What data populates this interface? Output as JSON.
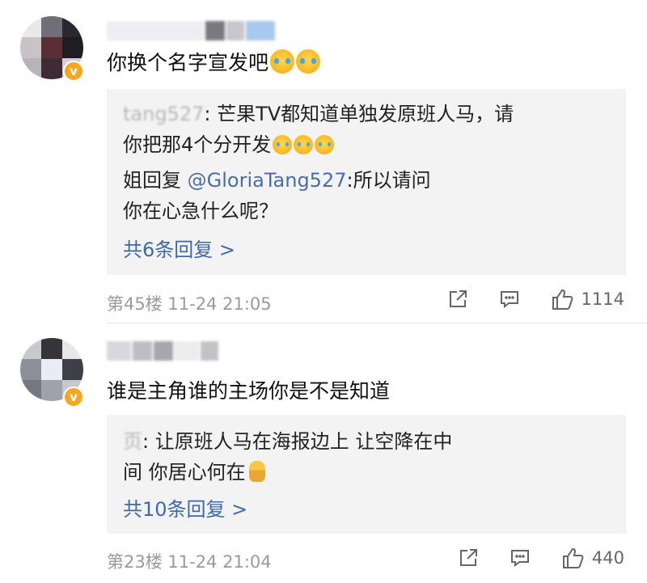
{
  "comments": [
    {
      "main_text": "你换个名字宣发吧",
      "replies": [
        {
          "author_tail": "tang527",
          "sep": ": ",
          "text_line1": "芒果TV都知道单独发原班人马，请",
          "text_line2": "你把那4个分开发"
        },
        {
          "author_tail": "姐",
          "reply_word": "回复",
          "mention": "@GloriaTang527",
          "text_after": ":所以请问",
          "text_line2": "你在心急什么呢？"
        }
      ],
      "more_replies": "共6条回复 >",
      "meta": "第45楼 11-24 21:05",
      "like_count": "1114"
    },
    {
      "main_text": "谁是主角谁的主场你是不是知道",
      "replies": [
        {
          "author_tail": "页",
          "sep": ": ",
          "text_line1": "让原班人马在海报边上 让空降在中",
          "text_line2": "间 你居心何在"
        }
      ],
      "more_replies": "共10条回复 >",
      "meta": "第23楼 11-24 21:04",
      "like_count": "440"
    }
  ],
  "icons": {
    "share": "share-icon",
    "comment": "comment-icon",
    "like": "thumbs-up-icon",
    "verified": "verified-badge-icon",
    "emoji": "crying-face-emoji"
  },
  "colors": {
    "link": "#3d6aa6",
    "badge": "#f5a623",
    "reply_bg": "#f3f3f3",
    "meta": "#9a9a9a"
  }
}
